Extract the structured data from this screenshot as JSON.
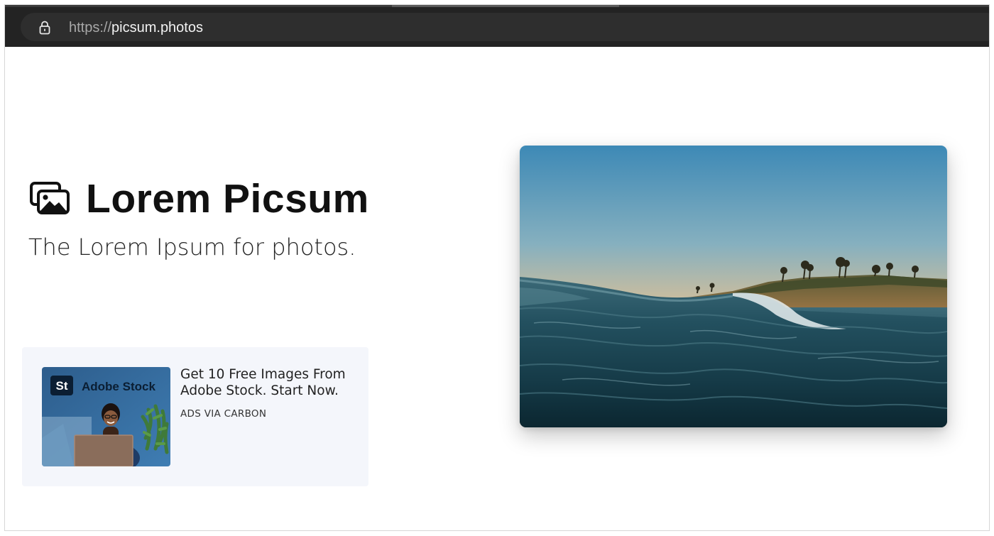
{
  "browser": {
    "url_scheme": "https://",
    "url_host": "picsum.photos"
  },
  "hero": {
    "icon": "images-icon",
    "title": "Lorem Picsum",
    "tagline": "The Lorem Ipsum for photos."
  },
  "ad": {
    "image_brand": "Adobe Stock",
    "image_logo": "St",
    "text": "Get 10 Free Images From Adobe Stock. Start Now.",
    "via": "ADS VIA CARBON"
  },
  "photo": {
    "subject": "ocean-wave-sunset-photo"
  },
  "colors": {
    "browser_bar": "#232323",
    "ad_background": "#f4f6fb",
    "title_text": "#111111"
  }
}
